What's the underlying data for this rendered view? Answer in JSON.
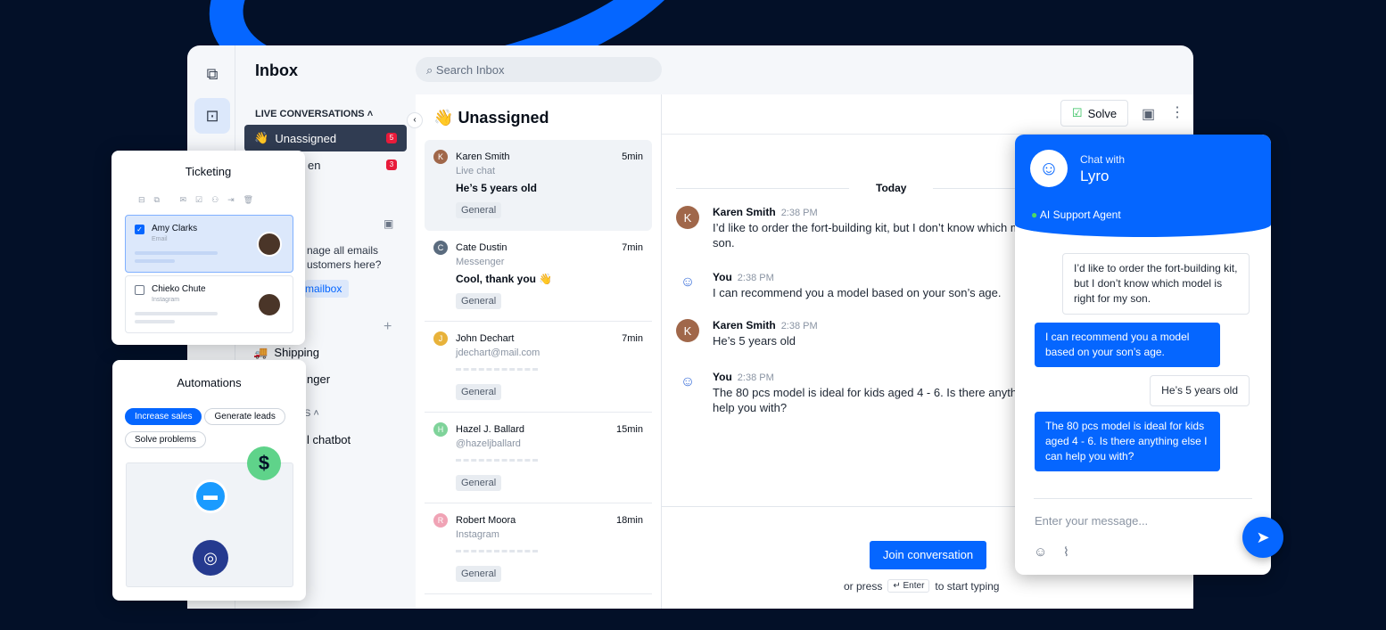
{
  "colors": {
    "accent": "#0566ff",
    "background": "#031028",
    "badge": "#e81b3a"
  },
  "header": {
    "title": "Inbox",
    "search_placeholder": "Search Inbox"
  },
  "sidebar": {
    "section": "LIVE CONVERSATIONS",
    "items": [
      {
        "label": "Unassigned",
        "count": "5",
        "emoji": "👋"
      },
      {
        "label": "en",
        "count": "3"
      }
    ],
    "promo": {
      "line1": "nage all emails",
      "line2": "ustomers here?",
      "button": "mailbox"
    },
    "items2": [
      {
        "label": "Shipping",
        "emoji": "🚚"
      },
      {
        "label": "nger"
      }
    ],
    "section2": "S",
    "items3": [
      {
        "label": "l chatbot"
      }
    ]
  },
  "list": {
    "title": "Unassigned",
    "emoji": "👋",
    "conversations": [
      {
        "initial": "K",
        "color": "#a0674a",
        "name": "Karen Smith",
        "time": "5min",
        "channel": "Live chat",
        "message": "He’s 5 years old",
        "tag": "General"
      },
      {
        "initial": "C",
        "color": "#5a6b7e",
        "name": "Cate Dustin",
        "time": "7min",
        "channel": "Messenger",
        "message": "Cool, thank you 👋",
        "tag": "General"
      },
      {
        "initial": "J",
        "color": "#e8b23a",
        "name": "John Dechart",
        "time": "7min",
        "channel": "jdechart@mail.com",
        "message": "",
        "tag": "General"
      },
      {
        "initial": "H",
        "color": "#7fd39a",
        "name": "Hazel J. Ballard",
        "time": "15min",
        "channel": "@hazeljballard",
        "message": "",
        "tag": "General"
      },
      {
        "initial": "R",
        "color": "#f0a3b5",
        "name": "Robert Moora",
        "time": "18min",
        "channel": "Instagram",
        "message": "",
        "tag": "General"
      }
    ]
  },
  "chat": {
    "solve": "Solve",
    "date": "Today",
    "messages": [
      {
        "author": "Karen Smith",
        "time": "2:38 PM",
        "text": "I’d like to order the fort-building kit, but I don’t know which mo son."
      },
      {
        "author": "You",
        "time": "2:38 PM",
        "text": "I can recommend you a model based on your son’s age."
      },
      {
        "author": "Karen Smith",
        "time": "2:38 PM",
        "text": "He’s 5 years old"
      },
      {
        "author": "You",
        "time": "2:38 PM",
        "text": "The 80 pcs model is ideal for kids aged 4 - 6. Is there anyth help you with?"
      }
    ],
    "join": "Join conversation",
    "or_press": "or press",
    "key": "↵ Enter",
    "to_start": "to start typing"
  },
  "lyro": {
    "chat_with": "Chat with",
    "name": "Lyro",
    "status": "AI Support Agent",
    "bubbles": [
      {
        "from": "user",
        "text": "I’d like to order the fort-building kit, but I don’t know which model is right for my son."
      },
      {
        "from": "bot",
        "text": "I can recommend you a model based on your son’s age."
      },
      {
        "from": "user",
        "text": "He’s 5 years old"
      },
      {
        "from": "bot",
        "text": "The 80 pcs model is ideal for kids aged 4 - 6. Is there anything else I can help you with?"
      }
    ],
    "input_placeholder": "Enter your message..."
  },
  "ticketing": {
    "title": "Ticketing",
    "tickets": [
      {
        "name": "Amy Clarks",
        "channel": "Email",
        "checked": true
      },
      {
        "name": "Chieko Chute",
        "channel": "Instagram",
        "checked": false
      }
    ]
  },
  "automations": {
    "title": "Automations",
    "chips": [
      "Increase sales",
      "Generate leads",
      "Solve problems"
    ]
  }
}
